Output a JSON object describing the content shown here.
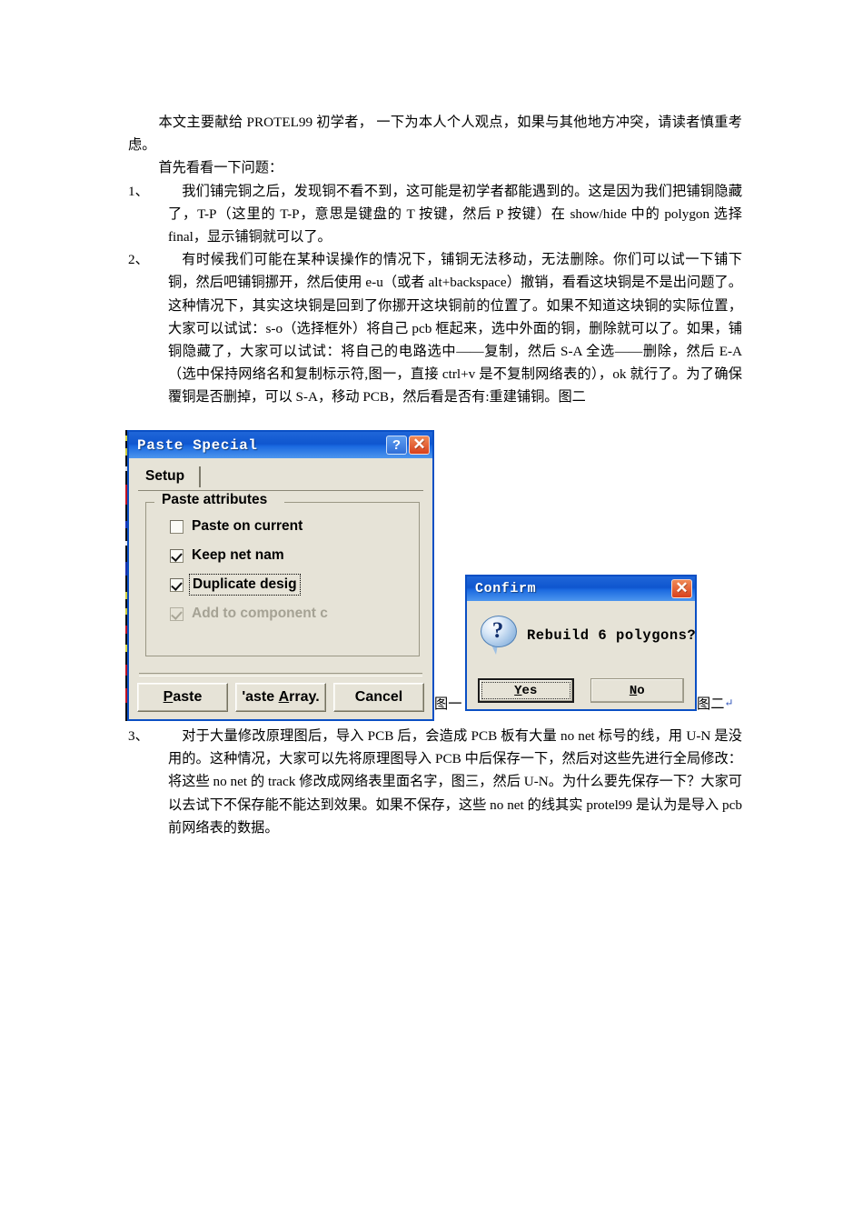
{
  "document": {
    "intro": {
      "p1": "本文主要献给 PROTEL99 初学者， 一下为本人个人观点，如果与其他地方冲突，请读者慎重考虑。",
      "p2": "首先看看一下问题："
    },
    "items": [
      {
        "num": "1、",
        "text": "我们铺完铜之后，发现铜不看不到，这可能是初学者都能遇到的。这是因为我们把铺铜隐藏了，T-P（这里的 T-P，意思是键盘的 T 按键，然后 P 按键）在 show/hide 中的 polygon 选择 final，显示铺铜就可以了。"
      },
      {
        "num": "2、",
        "text": "有时候我们可能在某种误操作的情况下，铺铜无法移动，无法删除。你们可以试一下铺下铜，然后吧铺铜挪开，然后使用 e-u（或者 alt+backspace）撤销，看看这块铜是不是出问题了。这种情况下，其实这块铜是回到了你挪开这块铜前的位置了。如果不知道这块铜的实际位置，大家可以试试：s-o（选择框外）将自己 pcb 框起来，选中外面的铜，删除就可以了。如果，铺铜隐藏了，大家可以试试：将自己的电路选中——复制，然后 S-A 全选——删除，然后 E-A（选中保持网络名和复制标示符,图一，直接 ctrl+v 是不复制网络表的），ok 就行了。为了确保覆铜是否删掉，可以 S-A，移动 PCB，然后看是否有:重建铺铜。图二"
      },
      {
        "num": "3、",
        "text": "对于大量修改原理图后，导入 PCB 后，会造成 PCB 板有大量 no net 标号的线，用 U-N 是没用的。这种情况，大家可以先将原理图导入 PCB 中后保存一下，然后对这些先进行全局修改：将这些 no net 的 track 修改成网络表里面名字，图三，然后 U-N。为什么要先保存一下？大家可以去试下不保存能不能达到效果。如果不保存，这些 no net 的线其实 protel99 是认为是导入 pcb 前网络表的数据。"
      }
    ],
    "captions": {
      "fig1": "图一",
      "fig2": "图二",
      "fig2_mark": "↵"
    }
  },
  "paste_special_dialog": {
    "title": "Paste Special",
    "help_button": "?",
    "close_button": "✕",
    "tab": "Setup",
    "group_title": "Paste attributes",
    "checkboxes": [
      {
        "label": "Paste on current",
        "checked": false,
        "disabled": false,
        "focused": false
      },
      {
        "label": "Keep net nam",
        "checked": true,
        "disabled": false,
        "focused": false
      },
      {
        "label": "Duplicate desig",
        "checked": true,
        "disabled": false,
        "focused": true
      },
      {
        "label": "Add to component c",
        "checked": true,
        "disabled": true,
        "focused": false
      }
    ],
    "buttons": {
      "paste": "Paste",
      "paste_array": "'aste Array.",
      "cancel": "Cancel"
    }
  },
  "confirm_dialog": {
    "title": "Confirm",
    "close_button": "✕",
    "icon": "question-mark",
    "message": "Rebuild 6 polygons?",
    "buttons": {
      "yes": "Yes",
      "no": "No"
    }
  },
  "colors": {
    "titlebar_blue": "#0f56cf",
    "dialog_face": "#e6e3d7",
    "close_red": "#d8401c",
    "help_blue": "#2f6ed8"
  }
}
